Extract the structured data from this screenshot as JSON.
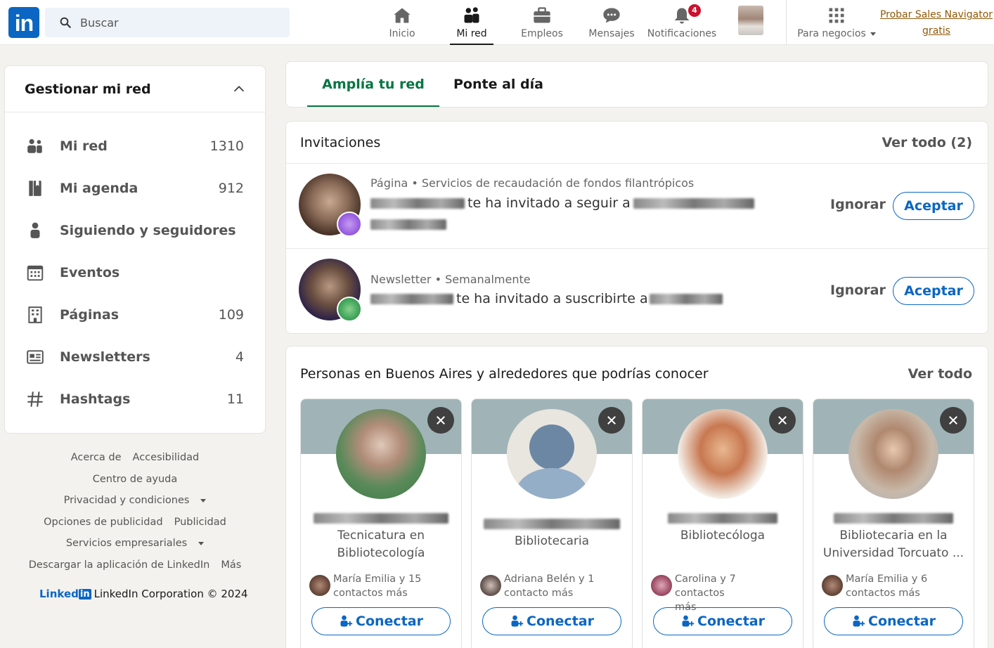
{
  "nav": {
    "logo_text": "in",
    "search_placeholder": "Buscar",
    "items": [
      {
        "label": "Inicio",
        "icon": "home-icon"
      },
      {
        "label": "Mi red",
        "icon": "network-icon"
      },
      {
        "label": "Empleos",
        "icon": "briefcase-icon"
      },
      {
        "label": "Mensajes",
        "icon": "message-icon"
      },
      {
        "label": "Notificaciones",
        "icon": "bell-icon"
      }
    ],
    "notifications_badge": "4",
    "business_label": "Para negocios",
    "sales_line1": "Probar Sales Navigator",
    "sales_line2": "gratis",
    "accent_color": "#0a66c2"
  },
  "sidebar": {
    "title": "Gestionar mi red",
    "items": [
      {
        "label": "Mi red",
        "count": "1310",
        "icon": "people-icon"
      },
      {
        "label": "Mi agenda",
        "count": "912",
        "icon": "contacts-book-icon"
      },
      {
        "label": "Siguiendo y seguidores",
        "count": "",
        "icon": "person-icon"
      },
      {
        "label": "Eventos",
        "count": "",
        "icon": "calendar-icon"
      },
      {
        "label": "Páginas",
        "count": "109",
        "icon": "building-icon"
      },
      {
        "label": "Newsletters",
        "count": "4",
        "icon": "newsletter-icon"
      },
      {
        "label": "Hashtags",
        "count": "11",
        "icon": "hashtag-icon"
      }
    ]
  },
  "footer": {
    "about": "Acerca de",
    "accessibility": "Accesibilidad",
    "help": "Centro de ayuda",
    "privacy": "Privacidad y condiciones",
    "ad_options": "Opciones de publicidad",
    "advertising": "Publicidad",
    "business_services": "Servicios empresariales",
    "download_app": "Descargar la aplicación de LinkedIn",
    "more": "Más",
    "brand_word": "Linked",
    "brand_in": "in",
    "copyright": "LinkedIn Corporation © 2024"
  },
  "tabs": {
    "grow": "Amplía tu red",
    "catchup": "Ponte al día",
    "active_color": "#057642"
  },
  "invitations": {
    "title": "Invitaciones",
    "view_all": "Ver todo (2)",
    "rows": [
      {
        "subtitle": "Página • Servicios de recaudación de fondos filantrópicos",
        "text": "te ha invitado a seguir a",
        "ignore": "Ignorar",
        "accept": "Aceptar"
      },
      {
        "subtitle": "Newsletter • Semanalmente",
        "text": "te ha invitado a suscribirte a",
        "ignore": "Ignorar",
        "accept": "Aceptar"
      }
    ]
  },
  "people": {
    "title": "Personas en Buenos Aires y alrededores que podrías conocer",
    "view_all": "Ver todo",
    "cards": [
      {
        "title_line1": "Tecnicatura en",
        "title_line2": "Bibliotecología",
        "mutual_line1": "María Emilia y 15",
        "mutual_line2": "contactos más",
        "connect": "Conectar"
      },
      {
        "title_line1": "Bibliotecaria",
        "title_line2": "",
        "mutual_line1": "Adriana Belén y 1",
        "mutual_line2": "contacto más",
        "connect": "Conectar"
      },
      {
        "title_line1": "Bibliotecóloga",
        "title_line2": "",
        "mutual_line1": "Carolina y 7 contactos",
        "mutual_line2": "más",
        "connect": "Conectar"
      },
      {
        "title_line1": "Bibliotecaria en la",
        "title_line2": "Universidad Torcuato ...",
        "mutual_line1": "María Emilia y 6",
        "mutual_line2": "contactos más",
        "connect": "Conectar"
      }
    ]
  }
}
